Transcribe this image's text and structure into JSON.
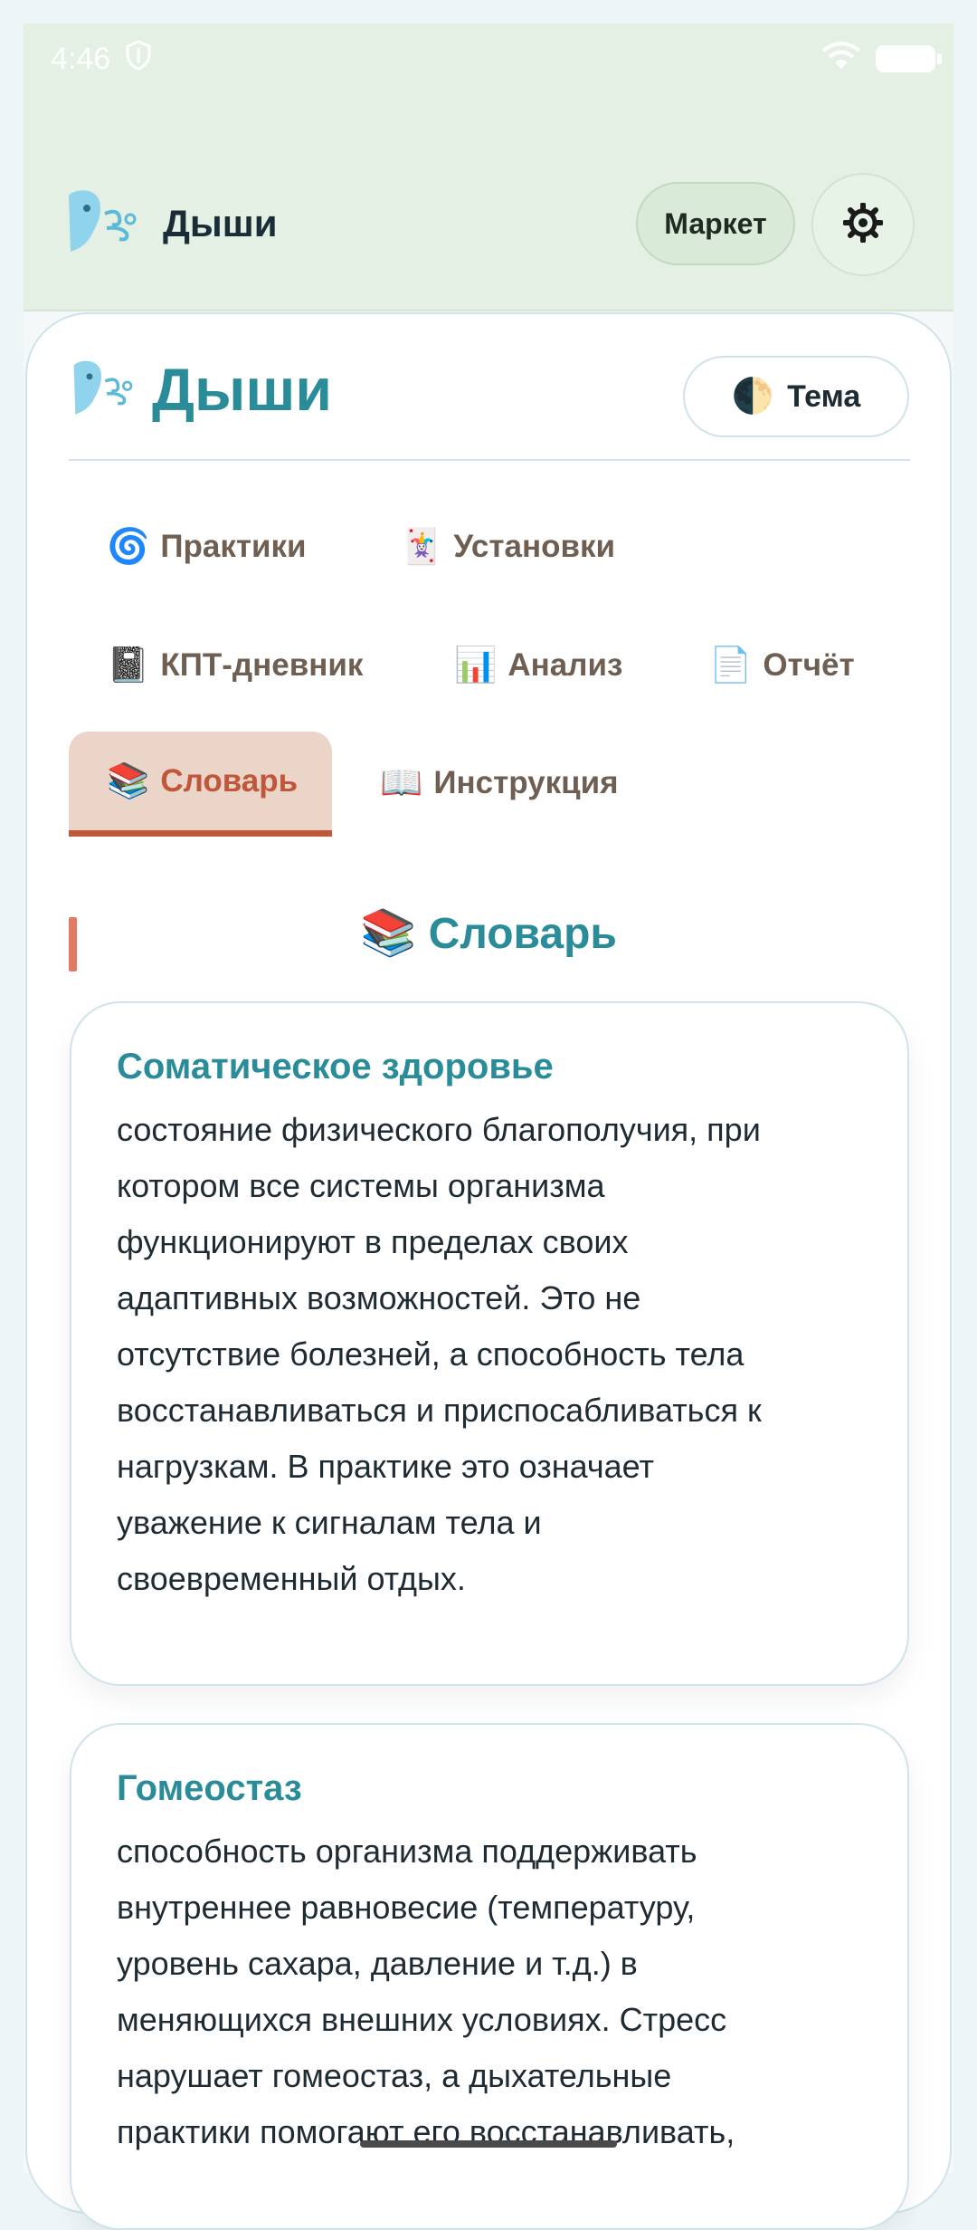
{
  "status_bar": {
    "time": "4:46"
  },
  "app_bar": {
    "title": "Дыши",
    "market_label": "Маркет"
  },
  "header": {
    "title": "Дыши",
    "theme_label": "Тема",
    "theme_emoji": "🌓"
  },
  "tabs": [
    {
      "emoji": "🌀",
      "label": "Практики"
    },
    {
      "emoji": "🃏",
      "label": "Установки"
    },
    {
      "emoji": "📓",
      "label": "КПТ-дневник"
    },
    {
      "emoji": "📊",
      "label": "Анализ"
    },
    {
      "emoji": "📄",
      "label": "Отчёт"
    },
    {
      "emoji": "📚",
      "label": "Словарь",
      "active": true
    },
    {
      "emoji": "📖",
      "label": "Инструкция"
    }
  ],
  "section": {
    "emoji": "📚",
    "title": "Словарь"
  },
  "glossary": [
    {
      "term": "Соматическое здоровье",
      "definition_lines": [
        "состояние физического благополучия, при",
        "котором все системы организма",
        "функционируют в пределах своих",
        "адаптивных возможностей. Это не",
        "отсутствие болезней, а способность тела",
        "восстанавливаться и приспосабливаться к",
        "нагрузкам. В практике это означает",
        "уважение к сигналам тела и",
        "своевременный отдых."
      ]
    },
    {
      "term": "Гомеостаз",
      "definition_lines": [
        "способность организма поддерживать",
        "внутреннее равновесие (температуру,",
        "уровень сахара, давление и т.д.) в",
        "меняющихся внешних условиях. Стресс",
        "нарушает гомеостаз, а дыхательные",
        "практики помогают его восстанавливать,"
      ]
    }
  ]
}
